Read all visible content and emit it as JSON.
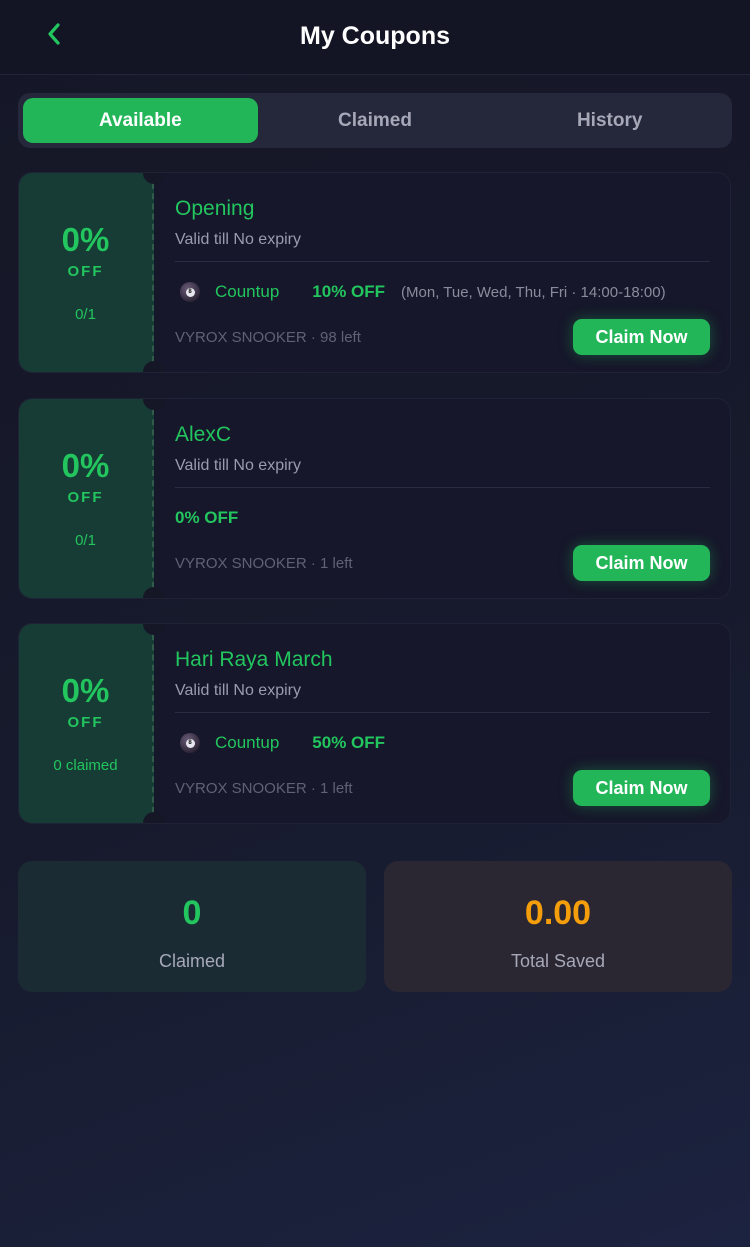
{
  "header": {
    "title": "My Coupons",
    "back_icon": "chevron-left-icon"
  },
  "tabs": [
    {
      "label": "Available",
      "active": true
    },
    {
      "label": "Claimed",
      "active": false
    },
    {
      "label": "History",
      "active": false
    }
  ],
  "coupons": [
    {
      "percent": "0%",
      "off": "OFF",
      "count": "0/1",
      "name": "Opening",
      "valid": "Valid till No expiry",
      "game": "Countup",
      "discount": "10% OFF",
      "schedule": "(Mon, Tue, Wed, Thu, Fri · 14:00-18:00)",
      "store": "VYROX SNOOKER · 98 left",
      "button": "Claim Now"
    },
    {
      "percent": "0%",
      "off": "OFF",
      "count": "0/1",
      "name": "AlexC",
      "valid": "Valid till No expiry",
      "discount": "0% OFF",
      "store": "VYROX SNOOKER · 1 left",
      "button": "Claim Now"
    },
    {
      "percent": "0%",
      "off": "OFF",
      "count": "0 claimed",
      "name": "Hari Raya March",
      "valid": "Valid till No expiry",
      "game": "Countup",
      "discount": "50% OFF",
      "store": "VYROX SNOOKER · 1 left",
      "button": "Claim Now"
    }
  ],
  "stats": {
    "claimed_value": "0",
    "claimed_label": "Claimed",
    "saved_value": "0.00",
    "saved_label": "Total Saved"
  },
  "colors": {
    "accent": "#22c55e",
    "saved": "#f59e0b",
    "background": "#151727"
  }
}
